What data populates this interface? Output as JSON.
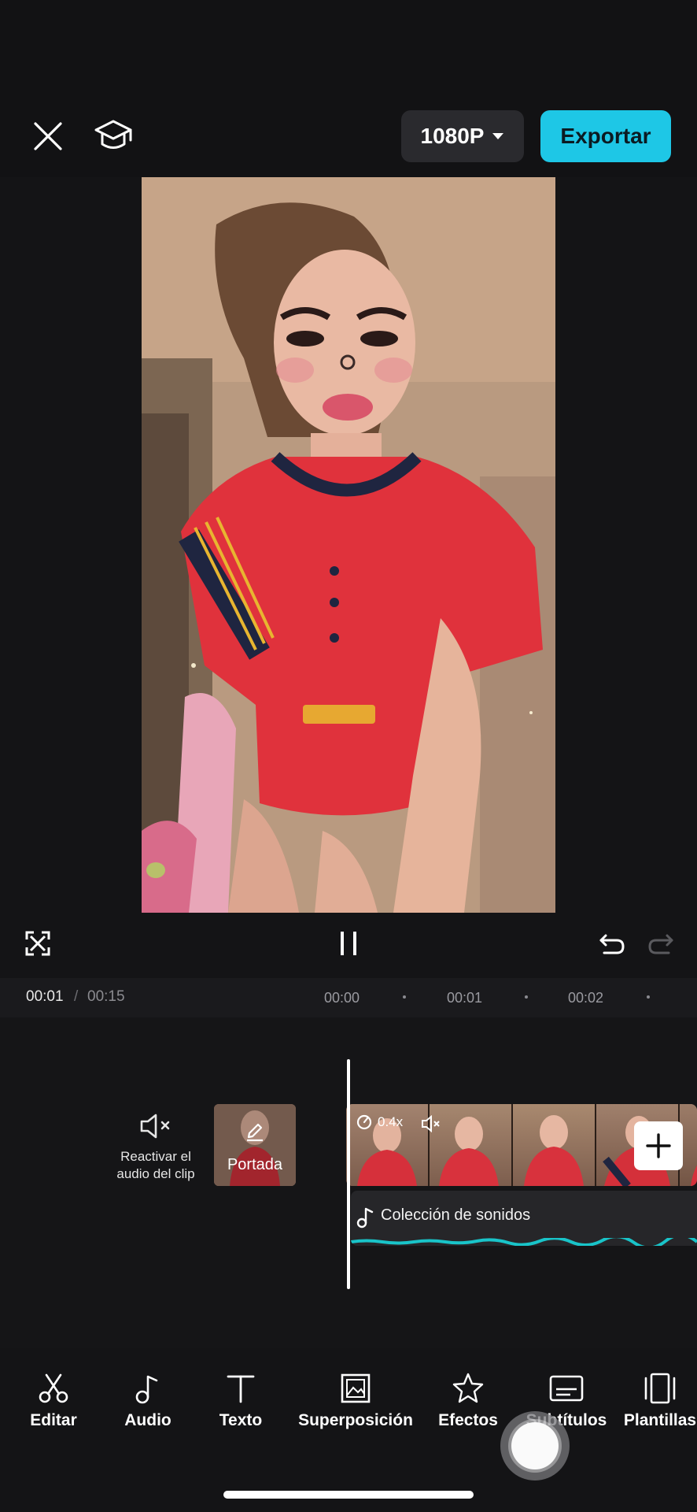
{
  "header": {
    "resolution_label": "1080P",
    "export_label": "Exportar"
  },
  "icons": {
    "close": "close-icon",
    "tutorial": "graduation-cap-icon",
    "fullscreen": "fullscreen-icon",
    "pause": "pause-icon",
    "undo": "undo-icon",
    "redo": "redo-icon"
  },
  "playback": {
    "current_time": "00:01",
    "separator": "/",
    "total_time": "00:15",
    "ruler_ticks": [
      "00:00",
      "00:01",
      "00:02"
    ]
  },
  "timeline": {
    "mute_label": "Reactivar el audio del clip",
    "cover_label": "Portada",
    "speed_label": "0.4x",
    "audio_track_label": "Colección de sonidos"
  },
  "toolbar": {
    "items": [
      {
        "label": "Editar",
        "icon": "scissors-icon"
      },
      {
        "label": "Audio",
        "icon": "music-note-icon"
      },
      {
        "label": "Texto",
        "icon": "text-icon"
      },
      {
        "label": "Superposición",
        "icon": "overlay-icon"
      },
      {
        "label": "Efectos",
        "icon": "effects-star-icon"
      },
      {
        "label": "Subtítulos",
        "icon": "captions-icon"
      },
      {
        "label": "Plantillas",
        "icon": "templates-icon"
      }
    ]
  },
  "colors": {
    "accent": "#1ec7e6",
    "background": "#141416",
    "audio_wave": "#19c4c9"
  }
}
